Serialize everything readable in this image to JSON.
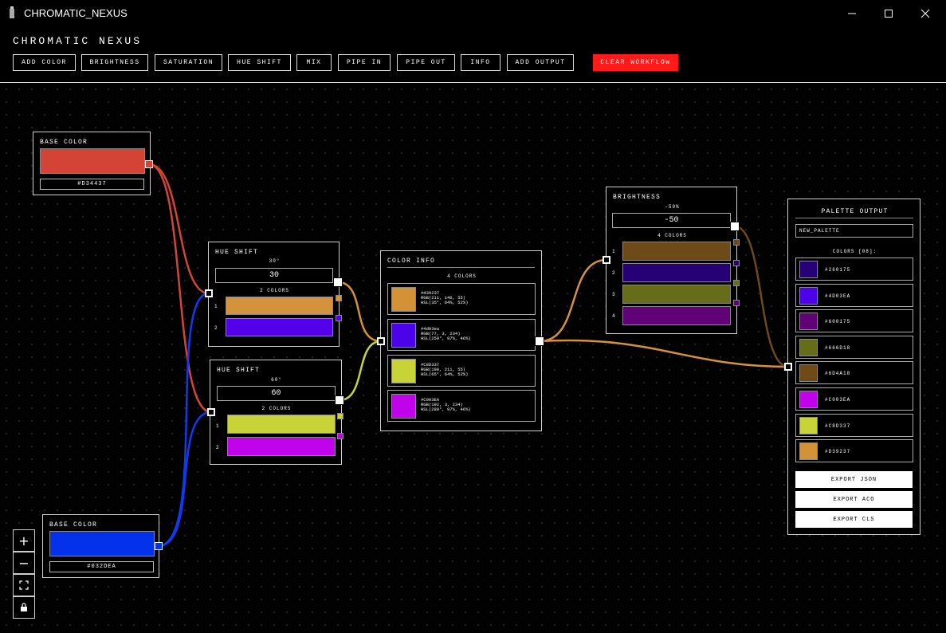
{
  "window": {
    "title": "CHROMATIC_NEXUS"
  },
  "header": {
    "title": "CHROMATIC NEXUS"
  },
  "toolbar": {
    "add_color": "ADD COLOR",
    "brightness": "BRIGHTNESS",
    "saturation": "SATURATION",
    "hue_shift": "HUE SHIFT",
    "mix": "MIX",
    "pipe_in": "PIPE IN",
    "pipe_out": "PIPE OUT",
    "info": "INFO",
    "add_output": "ADD OUTPUT",
    "clear": "CLEAR WORKFLOW"
  },
  "colors": {
    "accent_danger": "#ff1a1a",
    "wire_red": "#d24437",
    "wire_blue": "#0f3aee",
    "wire_orange": "#d4923a",
    "wire_yellow": "#c8d337",
    "wire_brown": "#6d4a18"
  },
  "nodes": {
    "base1": {
      "title": "BASE COLOR",
      "color": "#d34437",
      "hex": "#D34437"
    },
    "base2": {
      "title": "BASE COLOR",
      "color": "#0332ea",
      "hex": "#032DEA"
    },
    "hue1": {
      "title": "HUE SHIFT",
      "degree": "30°",
      "value": "30",
      "count": "2 COLORS",
      "rows": [
        {
          "index": "1",
          "color": "#d3923b"
        },
        {
          "index": "2",
          "color": "#5400ea"
        }
      ]
    },
    "hue2": {
      "title": "HUE SHIFT",
      "degree": "60°",
      "value": "60",
      "count": "2 COLORS",
      "rows": [
        {
          "index": "1",
          "color": "#c8d337"
        },
        {
          "index": "2",
          "color": "#c003ea"
        }
      ]
    },
    "info": {
      "title": "COLOR INFO",
      "count": "4 COLORS",
      "rows": [
        {
          "color": "#d39237",
          "hex": "#d39237",
          "rgb": "RGB(211, 146, 55)",
          "hsl": "HSL(35°, 64%, 52%)"
        },
        {
          "color": "#4d03ea",
          "hex": "#4d03ea",
          "rgb": "RGB(77, 3, 234)",
          "hsl": "HSL(259°, 97%, 46%)"
        },
        {
          "color": "#c8d337",
          "hex": "#C8D337",
          "rgb": "RGB(198, 211, 55)",
          "hsl": "HSL(65°, 64%, 52%)"
        },
        {
          "color": "#c003ea",
          "hex": "#C003EA",
          "rgb": "RGB(192, 3, 234)",
          "hsl": "HSL(289°, 97%, 46%)"
        }
      ]
    },
    "brightness": {
      "title": "BRIGHTNESS",
      "percent": "-50%",
      "value": "-50",
      "count": "4 COLORS",
      "rows": [
        {
          "index": "1",
          "color": "#6d4a18"
        },
        {
          "index": "2",
          "color": "#260175"
        },
        {
          "index": "3",
          "color": "#666d18"
        },
        {
          "index": "4",
          "color": "#600175"
        }
      ]
    },
    "output": {
      "title": "PALETTE OUTPUT",
      "name": "NEW_PALETTE",
      "count": "COLORS [08]:",
      "rows": [
        {
          "color": "#260175",
          "hex": "#260175"
        },
        {
          "color": "#4d03ea",
          "hex": "#4D03EA"
        },
        {
          "color": "#600175",
          "hex": "#600175"
        },
        {
          "color": "#666d18",
          "hex": "#666D18"
        },
        {
          "color": "#6d4a18",
          "hex": "#6D4A18"
        },
        {
          "color": "#c003ea",
          "hex": "#C003EA"
        },
        {
          "color": "#c8d337",
          "hex": "#C8D337"
        },
        {
          "color": "#d39237",
          "hex": "#D39237"
        }
      ],
      "export_json": "EXPORT JSON",
      "export_aco": "EXPORT ACO",
      "export_cls": "EXPORT CLS"
    }
  },
  "zoom_controls": {
    "zoom_in": "+",
    "zoom_out": "−",
    "fit": "⛶",
    "lock": "🔒"
  }
}
